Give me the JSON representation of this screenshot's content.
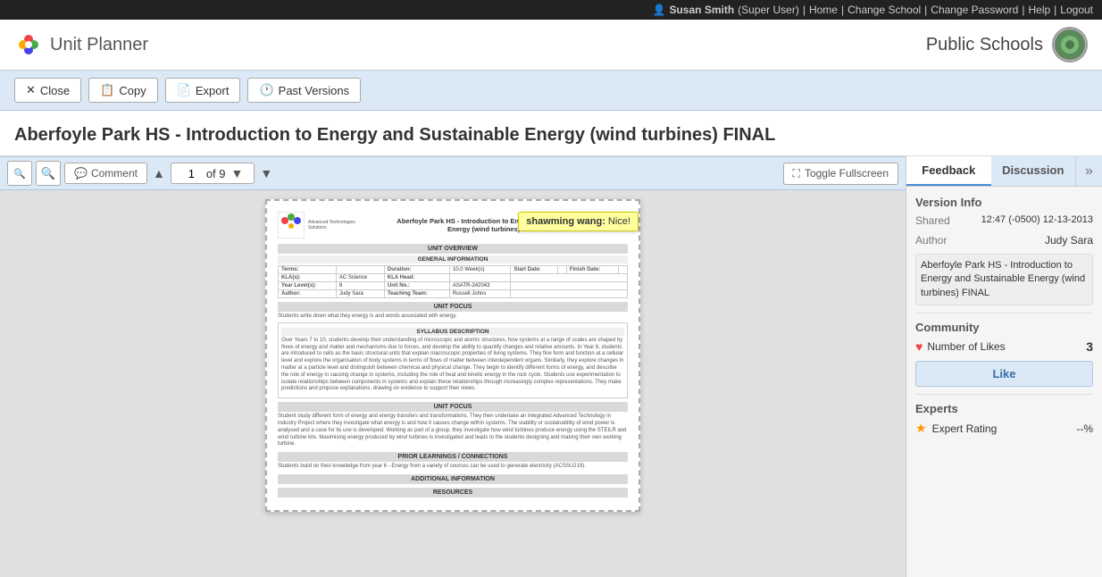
{
  "topnav": {
    "user_icon": "👤",
    "username": "Susan Smith",
    "role": "(Super User)",
    "links": [
      "Home",
      "Change School",
      "Change Password",
      "Help",
      "Logout"
    ],
    "separator": "|"
  },
  "header": {
    "logo_text": "Unit Planner",
    "school_name": "Public Schools"
  },
  "toolbar": {
    "close_label": "Close",
    "copy_label": "Copy",
    "export_label": "Export",
    "past_versions_label": "Past Versions",
    "close_icon": "✕",
    "copy_icon": "📋",
    "export_icon": "📄",
    "history_icon": "🕐"
  },
  "page_title": "Aberfoyle Park HS - Introduction to Energy and Sustainable Energy (wind turbines) FINAL",
  "viewer": {
    "zoom_in_icon": "🔍",
    "zoom_out_icon": "🔍",
    "comment_label": "Comment",
    "comment_icon": "💬",
    "page_current": "1",
    "page_total": "of 9",
    "prev_icon": "▲",
    "next_icon": "▼",
    "dropdown_icon": "▼",
    "fullscreen_label": "Toggle Fullscreen",
    "fullscreen_icon": "⛶"
  },
  "document": {
    "org_name": "Advanced Technologies",
    "title_line1": "Aberfoyle Park HS - Introduction to Energy and Sustainable",
    "title_line2": "Energy (wind turbines) final",
    "unit_overview_header": "UNIT OVERVIEW",
    "general_info_header": "GENERAL INFORMATION",
    "fields": {
      "terms_label": "Terms:",
      "terms_value": "",
      "duration_label": "Duration:",
      "duration_value": "10.0 Week(s)",
      "start_date_label": "Start Date:",
      "start_date_value": "",
      "finish_date_label": "Finish Date:",
      "finish_date_value": "",
      "kla_label": "KLA(s):",
      "kla_value": "AC Science",
      "kla_head_label": "KLA Head:",
      "kla_head_value": "",
      "year_level_label": "Year Level(s):",
      "year_level_value": "8",
      "unit_no_label": "Unit No.:",
      "unit_no_value": "ASATR-242043",
      "author_label": "Author:",
      "author_value": "Judy Sara",
      "teaching_team_label": "Teaching Team:",
      "teaching_team_value": "Russell Johns"
    },
    "unit_focus_header": "UNIT FOCUS",
    "unit_focus_text": "Students write down what they energy is and words associated with energy.",
    "syllabus_header": "SYLLABUS DESCRIPTION",
    "syllabus_text": "Over Years 7 to 10, students develop their understanding of microscopic and atomic structures, how systems at a range of scales are shaped by flows of energy and matter and mechanisms due to forces, and develop the ability to quantify changes and relative amounts. In Year 8, students are introduced to cells as the basic structural units that explain macroscopic properties of living systems. They fine form and function at a cellular level and explore the organisation of body systems in terms of flows of matter between interdependent organs. Similarly, they explore changes in matter at a particle level and distinguish between chemical and physical change. They begin to identify different forms of energy, and describe the role of energy in causing change in systems, including the role of heat and kinetic energy in the rock cycle. Students use experimentation to isolate relationships between components in systems and explain these relationships through increasingly complex representations. They make predictions and propose explanations, drawing on evidence to support their views.",
    "unit_focus2_header": "UNIT FOCUS",
    "unit_focus2_text": "Student study different form of energy and energy transfers and transformations. They then undertake an integrated Advanced Technology in industry Project where they investigate what energy is and how it causes change within systems. The viability or sustainability of wind power is analysed and a case for its use is developed. Working as part of a group, they investigate how wind turbines produce energy using the STEILR and wind turbine kits. Maximising energy produced by wind turbines is investigated and leads to the students designing and making their own working turbine.",
    "prior_learnings_header": "PRIOR LEARNINGS / CONNECTIONS",
    "prior_learnings_text": "Students build on their knowledge from year 6 - Energy from a variety of sources can be used to generate electricity (ACSSU219).",
    "additional_info_header": "ADDITIONAL INFORMATION",
    "resources_header": "RESOURCES"
  },
  "annotation": {
    "author": "shawming wang:",
    "text": " Nice!"
  },
  "right_panel": {
    "feedback_tab": "Feedback",
    "discussion_tab": "Discussion",
    "next_icon": "»",
    "version_info_title": "Version Info",
    "shared_label": "Shared",
    "shared_date": "12:47 (-0500) 12-13-2013",
    "author_label": "Author",
    "author_name": "Judy Sara",
    "unit_name": "Aberfoyle Park HS - Introduction to Energy and Sustainable Energy (wind turbines) FINAL",
    "community_title": "Community",
    "likes_label": "Number of Likes",
    "likes_count": "3",
    "like_btn_label": "Like",
    "experts_title": "Experts",
    "expert_rating_label": "Expert Rating",
    "expert_rating_value": "--%"
  }
}
